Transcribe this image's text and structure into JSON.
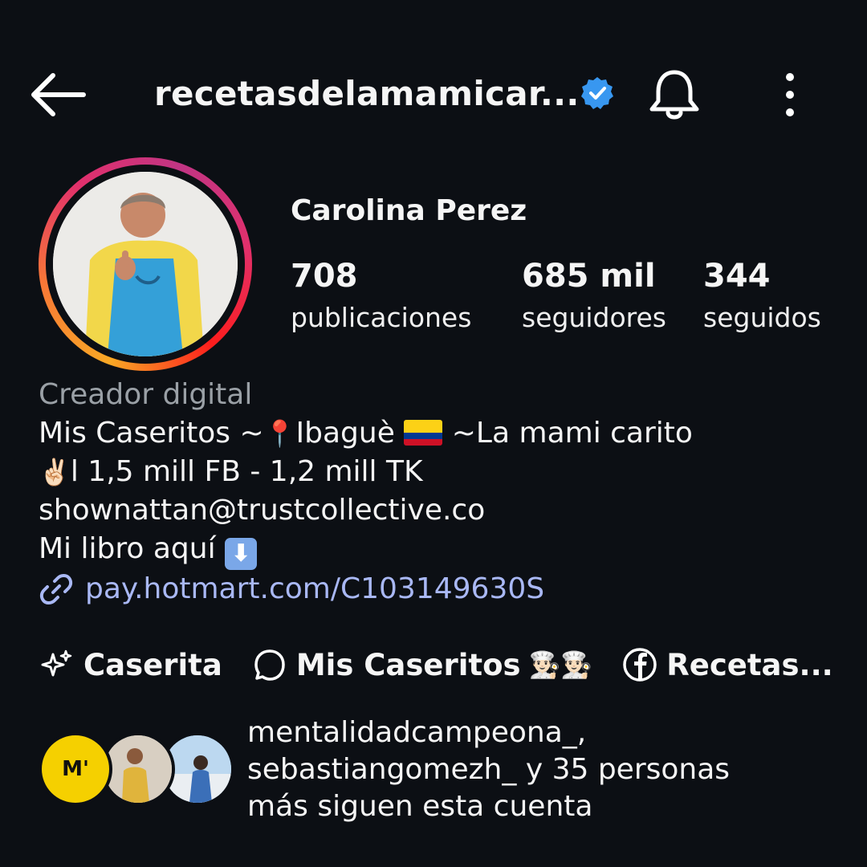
{
  "header": {
    "username": "recetasdelamamicar...",
    "icons": {
      "back": "back-arrow-icon",
      "verified": "verified-badge-icon",
      "bell": "bell-icon",
      "more": "more-vertical-icon"
    }
  },
  "profile": {
    "display_name": "Carolina Perez",
    "stats": [
      {
        "value": "708",
        "label": "publicaciones"
      },
      {
        "value": "685 mil",
        "label": "seguidores"
      },
      {
        "value": "344",
        "label": "seguidos"
      }
    ]
  },
  "bio": {
    "category": "Creador digital",
    "line1_a": "Mis Caseritos ~",
    "line1_pin": "📍",
    "line1_b": "Ibaguè",
    "line1_c": " ~La mami carito",
    "line2_hand": "✌🏻",
    "line2_text": "l 1,5 mill FB - 1,2 mill TK",
    "line3": "shownattan@trustcollective.co",
    "line4": "Mi libro aquí",
    "line4_arrow": "⬇",
    "link": "pay.hotmart.com/C103149630S"
  },
  "highlights": [
    {
      "label": "Caserita",
      "icon": "sparkles-icon"
    },
    {
      "label": "Mis Caseritos",
      "icon": "threads-chat-icon",
      "emoji": "👨🏻‍🍳👨🏻‍🍳"
    },
    {
      "label": "Recetas...",
      "icon": "facebook-icon"
    }
  ],
  "followed_by": {
    "line1": "mentalidadcampeona_,",
    "line2_user": "sebastiangomezh_",
    "line2_rest": " y 35 personas",
    "line3": "más siguen esta cuenta",
    "logo_text": "M'"
  },
  "colors": {
    "background": "#0c0f14",
    "verified": "#3897f0",
    "link": "#a9b8f5",
    "category": "#9aa0a6",
    "flag": [
      "#fcd116",
      "#003893",
      "#ce1126"
    ]
  }
}
